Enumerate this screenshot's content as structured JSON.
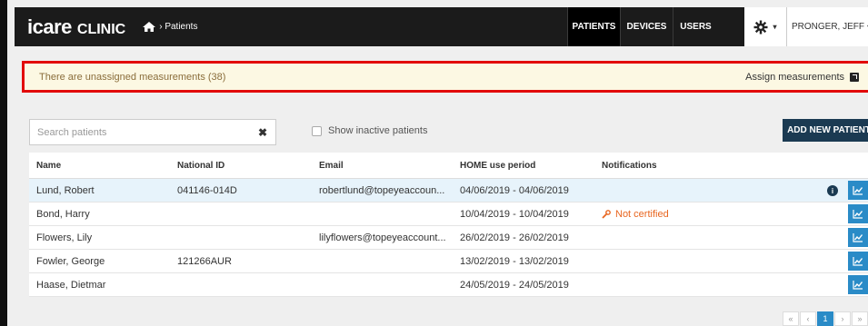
{
  "header": {
    "logo_main": "icare",
    "logo_sub": "CLINIC",
    "breadcrumb": "› Patients",
    "nav": {
      "patients": "PATIENTS",
      "devices": "DEVICES",
      "users": "USERS",
      "user_name": "PRONGER, JEFF"
    }
  },
  "alert": {
    "message": "There are unassigned measurements (38)",
    "action": "Assign measurements"
  },
  "toolbar": {
    "search_placeholder": "Search patients",
    "show_inactive_label": "Show inactive patients",
    "add_button": "ADD NEW PATIENT"
  },
  "table": {
    "headers": {
      "name": "Name",
      "national_id": "National ID",
      "email": "Email",
      "period": "HOME use period",
      "notifications": "Notifications"
    },
    "rows": [
      {
        "name": "Lund, Robert",
        "national_id": "041146-014D",
        "email": "robertlund@topeyeaccoun...",
        "period": "04/06/2019 - 04/06/2019",
        "notification": ""
      },
      {
        "name": "Bond, Harry",
        "national_id": "",
        "email": "",
        "period": "10/04/2019 - 10/04/2019",
        "notification": "Not certified"
      },
      {
        "name": "Flowers, Lily",
        "national_id": "",
        "email": "lilyflowers@topeyeaccount...",
        "period": "26/02/2019 - 26/02/2019",
        "notification": ""
      },
      {
        "name": "Fowler, George",
        "national_id": "121266AUR",
        "email": "",
        "period": "13/02/2019 - 13/02/2019",
        "notification": ""
      },
      {
        "name": "Haase, Dietmar",
        "national_id": "",
        "email": "",
        "period": "24/05/2019 - 24/05/2019",
        "notification": ""
      }
    ],
    "info_glyph": "i"
  },
  "pagination": {
    "first": "«",
    "prev": "‹",
    "current": "1",
    "next": "›",
    "last": "»"
  },
  "icons": {
    "home": "home-icon",
    "settings": "gear-icon",
    "assign": "external-link-icon",
    "clear": "close-icon",
    "wrench": "wrench-icon",
    "info": "info-icon",
    "chart": "line-chart-icon"
  },
  "colors": {
    "alert_border": "#e20a0a",
    "accent": "#2a8bc7",
    "navy": "#1b3a52",
    "warning": "#e8651f"
  }
}
